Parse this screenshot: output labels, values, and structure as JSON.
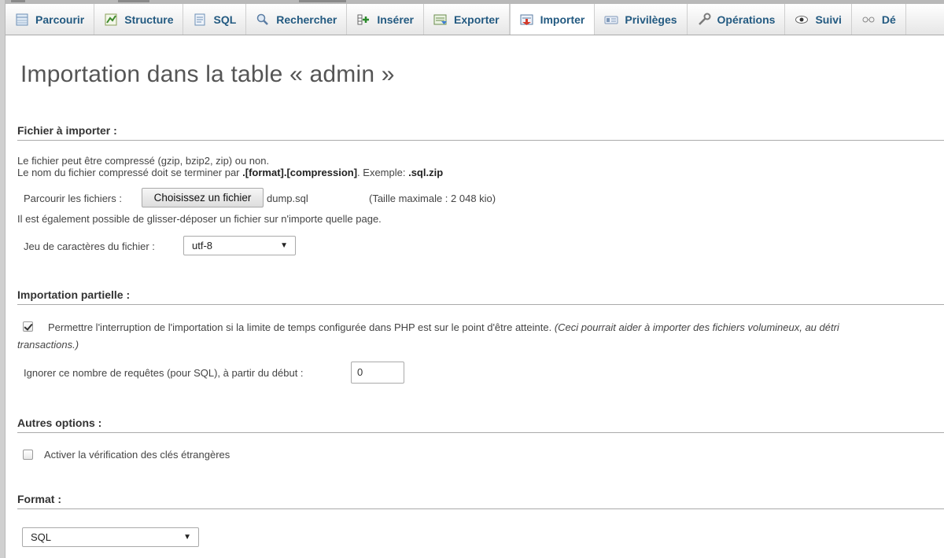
{
  "tabs": [
    {
      "label": "Parcourir",
      "icon": "browse-icon"
    },
    {
      "label": "Structure",
      "icon": "structure-icon"
    },
    {
      "label": "SQL",
      "icon": "sql-icon"
    },
    {
      "label": "Rechercher",
      "icon": "search-icon"
    },
    {
      "label": "Insérer",
      "icon": "insert-icon"
    },
    {
      "label": "Exporter",
      "icon": "export-icon"
    },
    {
      "label": "Importer",
      "icon": "import-icon",
      "active": true
    },
    {
      "label": "Privilèges",
      "icon": "privileges-icon"
    },
    {
      "label": "Opérations",
      "icon": "operations-icon"
    },
    {
      "label": "Suivi",
      "icon": "tracking-icon"
    },
    {
      "label": "Dé",
      "icon": "triggers-icon"
    }
  ],
  "page": {
    "title": "Importation dans la table « admin »"
  },
  "file_section": {
    "heading": "Fichier à importer :",
    "line1": "Le fichier peut être compressé (gzip, bzip2, zip) ou non.",
    "line2_prefix": "Le nom du fichier compressé doit se terminer par ",
    "line2_bold": ".[format].[compression]",
    "line2_mid": ". Exemple: ",
    "line2_example": ".sql.zip",
    "browse_label": "Parcourir les fichiers :",
    "choose_button": "Choisissez un fichier",
    "chosen_file": "dump.sql",
    "max_size": "(Taille maximale : 2 048 kio)",
    "dragdrop_note": "Il est également possible de glisser-déposer un fichier sur n'importe quelle page.",
    "charset_label": "Jeu de caractères du fichier :",
    "charset_value": "utf-8"
  },
  "partial_section": {
    "heading": "Importation partielle :",
    "allow_interrupt_checked": true,
    "allow_interrupt_label": "Permettre l'interruption de l'importation si la limite de temps configurée dans PHP est sur le point d'être atteinte.",
    "allow_interrupt_note": "(Ceci pourrait aider à importer des fichiers volumineux, au détri",
    "allow_interrupt_note_cont": "transactions.)",
    "skip_label": "Ignorer ce nombre de requêtes (pour SQL), à partir du début :",
    "skip_value": "0"
  },
  "other_section": {
    "heading": "Autres options :",
    "fk_checked": false,
    "fk_label": "Activer la vérification des clés étrangères"
  },
  "format_section": {
    "heading": "Format :",
    "format_value": "SQL"
  },
  "colors": {
    "tab_text": "#235a81",
    "heading": "#333333",
    "rule": "#aaaaaa"
  }
}
